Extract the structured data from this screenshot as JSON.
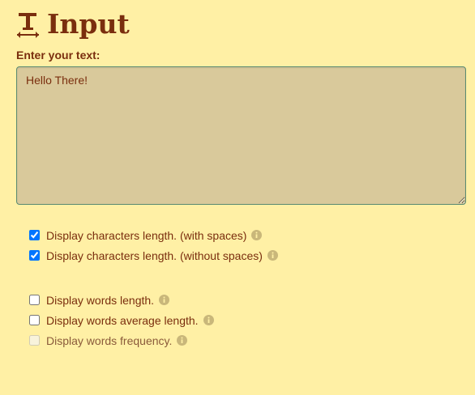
{
  "header": {
    "icon": "text-cursor-icon",
    "title": "Input"
  },
  "input": {
    "label": "Enter your text:",
    "value": "Hello There!"
  },
  "options": [
    {
      "label": "Display characters length. (with spaces)",
      "checked": true,
      "disabled": false
    },
    {
      "label": "Display characters length. (without spaces)",
      "checked": true,
      "disabled": false
    },
    {
      "label": "Display words length.",
      "checked": false,
      "disabled": false
    },
    {
      "label": "Display words average length.",
      "checked": false,
      "disabled": false
    },
    {
      "label": "Display words frequency.",
      "checked": false,
      "disabled": true
    }
  ],
  "colors": {
    "background": "#fff0a5",
    "text": "#7a2e0e",
    "textarea_bg": "#d9c99b",
    "textarea_border": "#5a8a72",
    "info_icon": "#c9b77a"
  }
}
